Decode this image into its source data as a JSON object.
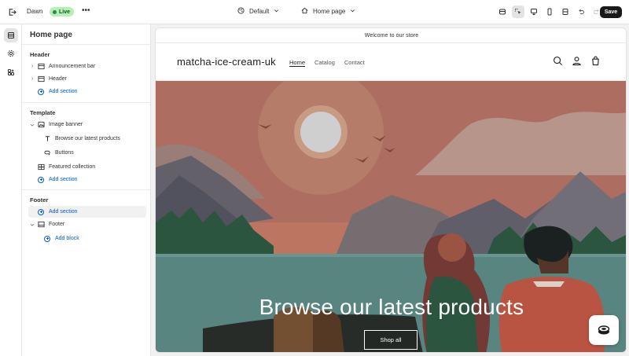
{
  "topbar": {
    "theme_name": "Dawn",
    "live_label": "Live",
    "more_label": "•••",
    "preset_label": "Default",
    "page_label": "Home page",
    "save_label": "Save"
  },
  "sidebar": {
    "title": "Home page",
    "header_group": "Header",
    "header_items": [
      {
        "label": "Announcement bar"
      },
      {
        "label": "Header"
      }
    ],
    "add_section": "Add section",
    "template_group": "Template",
    "template_items": {
      "image_banner": "Image banner",
      "heading_block": "Browse our latest products",
      "buttons_block": "Buttons",
      "featured_collection": "Featured collection"
    },
    "footer_group": "Footer",
    "footer_item": "Footer",
    "add_block": "Add block"
  },
  "preview": {
    "announcement": "Welcome to our store",
    "store_name": "matcha-ice-cream-uk",
    "nav": [
      "Home",
      "Catalog",
      "Contact"
    ],
    "banner_heading": "Browse our latest products",
    "banner_button": "Shop all"
  },
  "colors": {
    "accent_blue": "#005bd3",
    "live_badge_bg": "#b5f1b0",
    "save_button_bg": "#1a1a1a"
  },
  "icons": [
    "exit-icon",
    "preset-icon",
    "home-icon",
    "inspector-icon",
    "select-icon",
    "desktop-icon",
    "mobile-icon",
    "fullwidth-icon",
    "undo-icon",
    "redo-icon",
    "sections-icon",
    "settings-icon",
    "apps-icon",
    "search-icon",
    "account-icon",
    "cart-icon",
    "chat-icon"
  ]
}
